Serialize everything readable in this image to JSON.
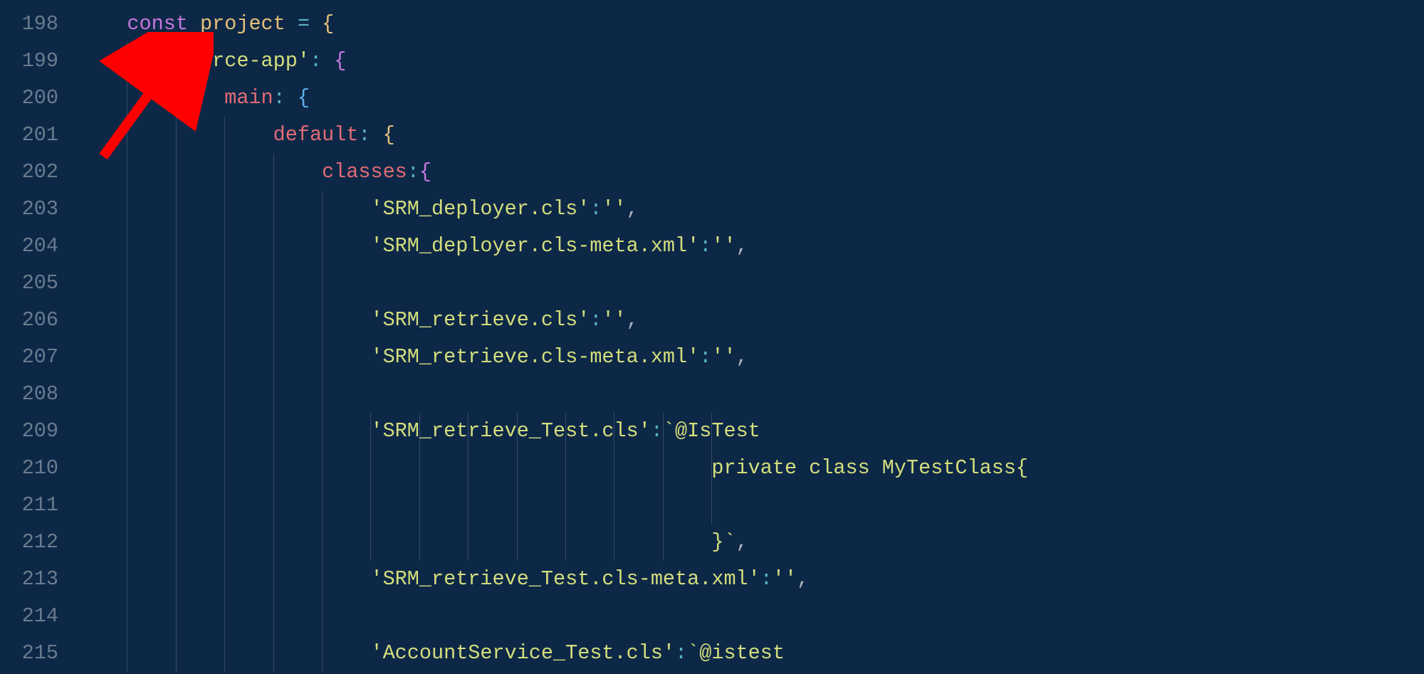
{
  "gutter": {
    "start": 198,
    "count": 18
  },
  "tokens": {
    "kw_const": "const",
    "var_project": "project",
    "op_eq": "=",
    "brace_open": "{",
    "brace_close": "}",
    "prop_forceapp": "'force-app'",
    "colon": ":",
    "prop_main": "main",
    "prop_default": "default",
    "prop_classes": "classes",
    "s_deployer_cls": "'SRM_deployer.cls'",
    "s_deployer_meta": "'SRM_deployer.cls-meta.xml'",
    "s_retrieve_cls": "'SRM_retrieve.cls'",
    "s_retrieve_meta": "'SRM_retrieve.cls-meta.xml'",
    "s_retrieve_test_cls": "'SRM_retrieve_Test.cls'",
    "s_istest_cap": "`@IsTest",
    "s_private_class": "private class MyTestClass{",
    "s_closebrace_tick": "}`",
    "s_retrieve_test_meta": "'SRM_retrieve_Test.cls-meta.xml'",
    "s_account_test": "'AccountService_Test.cls'",
    "s_istest_low": "`@istest",
    "s_empty": "''",
    "comma": ","
  }
}
